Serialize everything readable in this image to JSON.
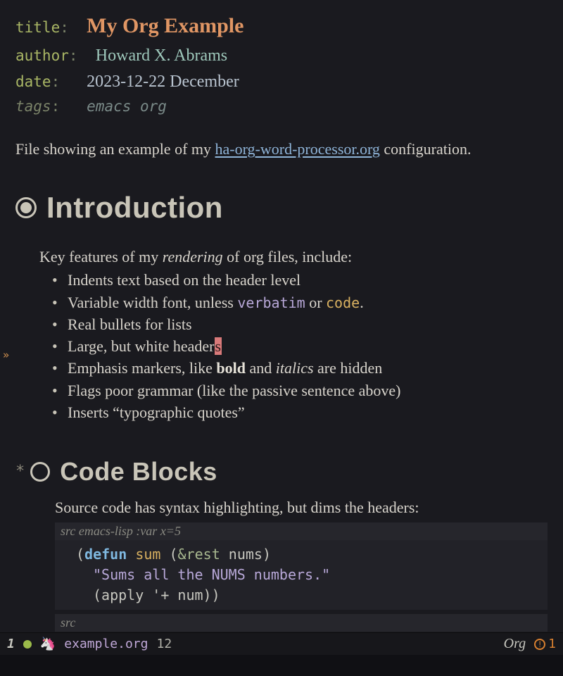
{
  "meta": {
    "title_key": "title",
    "title_val": "My Org Example",
    "author_key": "author",
    "author_val": "Howard X. Abrams",
    "date_key": "date",
    "date_val": "2023-12-22 December",
    "tags_key": "tags",
    "tags_val": "emacs org"
  },
  "intro": {
    "before_link": "File showing an example of my ",
    "link_text": "ha-org-word-processor.org",
    "after_link": " configuration."
  },
  "sections": {
    "s1": {
      "heading": "Introduction",
      "lead_before_em": "Key features of my ",
      "lead_em": "rendering",
      "lead_after_em": " of org files, include:",
      "items": {
        "i0": "Indents text based on the header level",
        "i1_a": "Variable width font, unless ",
        "i1_verbatim": "verbatim",
        "i1_b": " or ",
        "i1_code": "code",
        "i1_c": ".",
        "i2": "Real bullets for lists",
        "i3_a": "Large, but white header",
        "i3_cursor": "s",
        "i4_a": "Emphasis markers, like ",
        "i4_bold": "bold",
        "i4_b": " and ",
        "i4_italic": "italics",
        "i4_c": " are hidden",
        "i5": "Flags poor grammar (like the passive sentence above)",
        "i6": "Inserts “typographic quotes”"
      }
    },
    "s2": {
      "heading": "Code Blocks",
      "lead": "Source code has syntax highlighting, but dims the headers:",
      "src_begin": "src",
      "src_lang": " emacs-lisp :var x=5",
      "src_end": "src",
      "code": {
        "l1_a": "(",
        "l1_defun": "defun",
        "l1_b": " ",
        "l1_name": "sum",
        "l1_c": " (",
        "l1_amp": "&rest",
        "l1_d": " nums)",
        "l2": "\"Sums all the NUMS numbers.\"",
        "l3": "(apply '+ num))"
      }
    }
  },
  "modeline": {
    "window_number": "1",
    "filename": "example.org",
    "line": "12",
    "major_mode": "Org",
    "warn_count": "1"
  }
}
